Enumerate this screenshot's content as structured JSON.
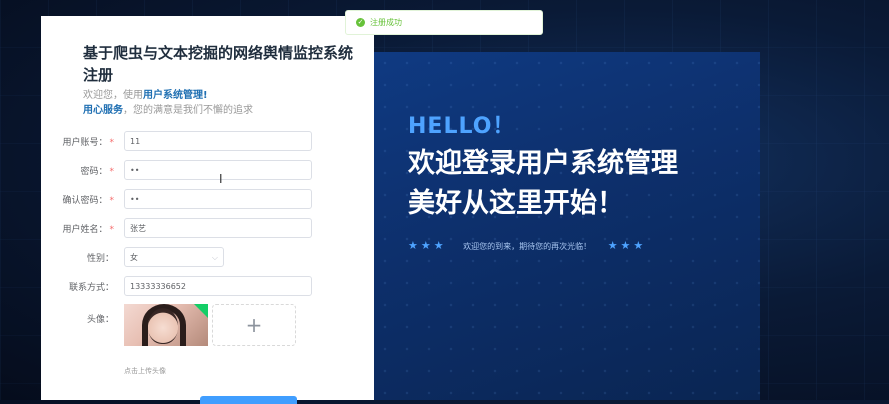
{
  "toast": {
    "text": "注册成功"
  },
  "form": {
    "title": "基于爬虫与文本挖掘的网络舆情监控系统注册",
    "welcome_prefix": "欢迎您，使用",
    "welcome_highlight": "用户系统管理",
    "welcome_suffix": "!",
    "service_highlight": "用心服务",
    "service_suffix": "，您的满意是我们不懈的追求",
    "fields": [
      {
        "label": "用户账号：",
        "required": true,
        "value": "11"
      },
      {
        "label": "密码：",
        "required": true,
        "value": "••"
      },
      {
        "label": "确认密码：",
        "required": true,
        "value": "••"
      },
      {
        "label": "用户姓名：",
        "required": true,
        "value": "张艺"
      },
      {
        "label": "性别：",
        "required": false,
        "value": "女"
      },
      {
        "label": "联系方式：",
        "required": false,
        "value": "13333336652"
      }
    ],
    "avatar_label": "头像：",
    "upload_tip": "点击上传头像",
    "upload_plus": "+"
  },
  "hero": {
    "hello": "HELLO！",
    "line1": "欢迎登录用户系统管理",
    "line2": "美好从这里开始！",
    "stars": "★★★",
    "tagline": "欢迎您的到来，期待您的再次光临！"
  },
  "colors": {
    "accent": "#409eff",
    "success": "#67c23a",
    "required": "#f56c6c"
  }
}
